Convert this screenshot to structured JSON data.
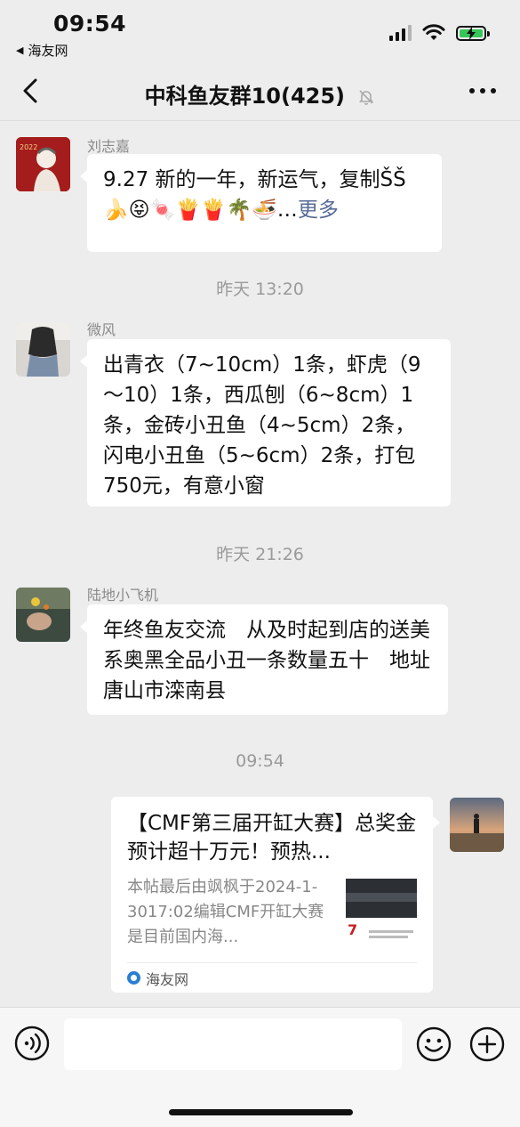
{
  "status_bar": {
    "time": "09:54",
    "back_app_label": "海友网",
    "battery_color": "#35c759"
  },
  "nav": {
    "title": "中科鱼友群10(425)",
    "back_icon": "chevron-left-icon",
    "mute_icon": "bell-slash-icon",
    "more_icon": "ellipsis-icon"
  },
  "messages": [
    {
      "sender": "刘志嘉",
      "text": "9.27 新的一年，新运气，复制ŠŠ🍌😝🍬🍟🍟🌴🍜…",
      "more_label": "更多"
    },
    {
      "timestamp": "昨天 13:20"
    },
    {
      "sender": "微风",
      "text": "出青衣（7~10cm）1条，虾虎（9～10）1条，西瓜刨（6~8cm）1条，金砖小丑鱼（4~5cm）2条，闪电小丑鱼（5~6cm）2条，打包750元，有意小窗"
    },
    {
      "timestamp": "昨天 21:26"
    },
    {
      "sender": "陆地小飞机",
      "text": "年终鱼友交流　从及时起到店的送美系奥黑全品小丑一条数量五十　地址唐山市滦南县"
    },
    {
      "timestamp": "09:54"
    },
    {
      "card": {
        "title": "【CMF第三届开缸大赛】总奖金预计超十万元！预热...",
        "description": "本帖最后由飒枫于2024-1-3017:02编辑CMF开缸大赛是目前国内海...",
        "thumb_caption": "7",
        "source": "海友网"
      }
    }
  ],
  "input_bar": {
    "voice_icon": "voice-icon",
    "emoji_icon": "emoji-icon",
    "plus_icon": "plus-icon"
  }
}
